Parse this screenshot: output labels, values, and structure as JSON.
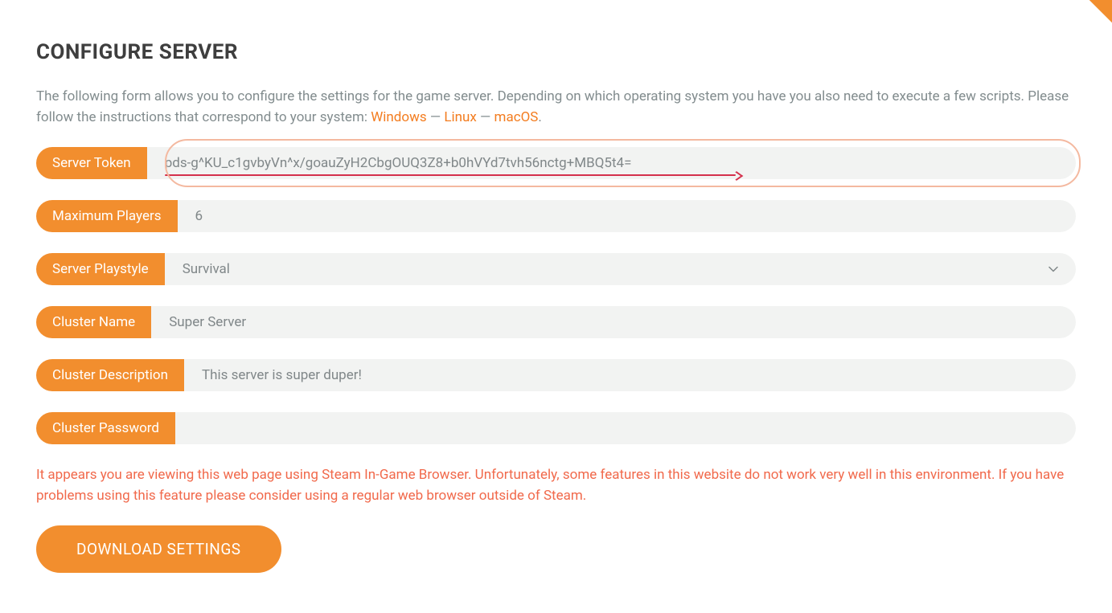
{
  "title": "CONFIGURE SERVER",
  "description": {
    "text_before": "The following form allows you to configure the settings for the game server. Depending on which operating system you have you also need to execute a few scripts. Please follow the instructions that correspond to your system: ",
    "links": {
      "windows": "Windows",
      "linux": "Linux",
      "macos": "macOS"
    },
    "separator": " — "
  },
  "form": {
    "server_token": {
      "label": "Server Token",
      "value": "pds-g^KU_c1gvbyVn^x/goauZyH2CbgOUQ3Z8+b0hVYd7tvh56nctg+MBQ5t4="
    },
    "max_players": {
      "label": "Maximum Players",
      "value": "6"
    },
    "playstyle": {
      "label": "Server Playstyle",
      "value": "Survival"
    },
    "cluster_name": {
      "label": "Cluster Name",
      "placeholder": "Super Server",
      "value": ""
    },
    "cluster_description": {
      "label": "Cluster Description",
      "placeholder": "This server is super duper!",
      "value": ""
    },
    "cluster_password": {
      "label": "Cluster Password",
      "value": ""
    }
  },
  "warning": "It appears you are viewing this web page using Steam In-Game Browser. Unfortunately, some features in this website do not work very well in this environment. If you have problems using this feature please consider using a regular web browser outside of Steam.",
  "download_button": "DOWNLOAD SETTINGS"
}
